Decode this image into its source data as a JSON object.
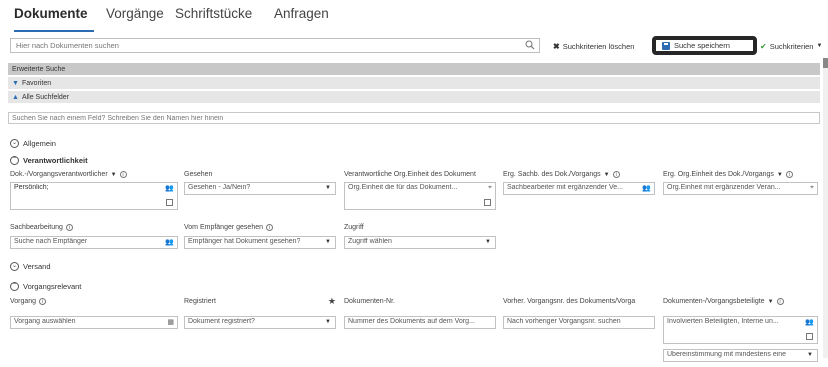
{
  "tabs": [
    "Dokumente",
    "Vorgänge",
    "Schriftstücke",
    "Anfragen"
  ],
  "toolbar": {
    "search_placeholder": "Hier nach Dokumenten suchen",
    "clear_label": "Suchkriterien löschen",
    "save_label": "Suche speichern",
    "criteria_label": "Suchkriterien"
  },
  "sections": {
    "advanced": "Erweiterte Suche",
    "favorites": "Favoriten",
    "all_fields": "Alle Suchfelder"
  },
  "field_search_placeholder": "Suchen Sie nach einem Feld? Schreiben Sie den Namen hier hinein",
  "groups": {
    "allgemein": "Allgemein",
    "verantwortlichkeit": "Verantwortlichkeit",
    "versand": "Versand",
    "vorgangsrelevant": "Vorgangsrelevant"
  },
  "verantwortlichkeit": {
    "row1": {
      "labels": [
        "Dok.-/Vorgangsverantwortlicher",
        "Gesehen",
        "Verantwortliche Org.Einheit des Dokument",
        "Erg. Sachb. des Dok./Vorgangs",
        "Erg. Org.Einheit des Dok./Vorgangs"
      ],
      "values": [
        "Persönlich;",
        "Gesehen - Ja/Nein?",
        "Org.Einheit die für das Dokument...",
        "Sachbearbeiter mit ergänzender Ve...",
        "Org.Einheit mit ergänzender Veran..."
      ]
    },
    "row2": {
      "labels": [
        "Sachbearbeitung",
        "Vom Empfänger gesehen",
        "Zugriff"
      ],
      "values": [
        "Suche nach Empfänger",
        "Empfänger hat Dokument gesehen?",
        "Zugriff wählen"
      ]
    }
  },
  "vorgangsrelevant": {
    "labels": [
      "Vorgang",
      "Registriert",
      "Dokumenten-Nr.",
      "Vorher. Vorgangsnr. des Dokuments/Vorga",
      "Dokumenten-/Vorgangsbeteiligte"
    ],
    "values": [
      "Vorgang auswählen",
      "Dokument registriert?",
      "Nummer des Dokuments auf dem Vorg...",
      "Nach vorheriger Vorgangsnr. suchen",
      "Involvierten Beteiligten, Interne un..."
    ],
    "extra_select": "Übereinstimmung mit mindestens eine"
  },
  "colors": {
    "accent": "#2b6cb3",
    "highlight_border": "#262626",
    "section_gray": "#c8c8c8"
  }
}
